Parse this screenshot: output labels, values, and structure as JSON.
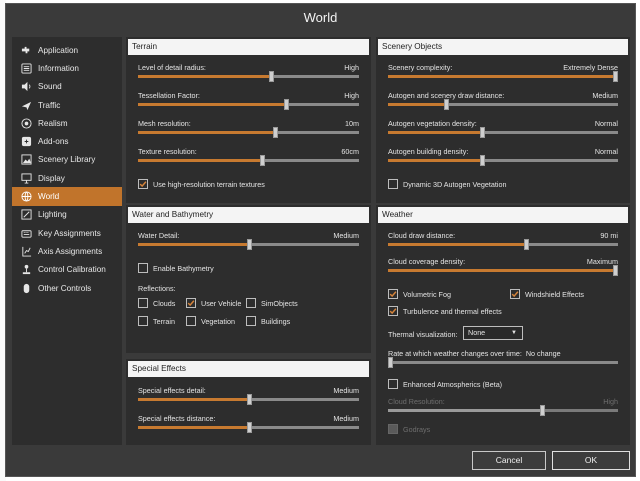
{
  "window": {
    "title": "World"
  },
  "sidebar": {
    "items": [
      {
        "label": "Application",
        "icon": "puzzle-icon"
      },
      {
        "label": "Information",
        "icon": "list-icon"
      },
      {
        "label": "Sound",
        "icon": "speaker-icon"
      },
      {
        "label": "Traffic",
        "icon": "airplane-icon"
      },
      {
        "label": "Realism",
        "icon": "target-icon"
      },
      {
        "label": "Add-ons",
        "icon": "addons-icon"
      },
      {
        "label": "Scenery Library",
        "icon": "scenery-icon"
      },
      {
        "label": "Display",
        "icon": "monitor-icon"
      },
      {
        "label": "World",
        "icon": "globe-icon",
        "active": true
      },
      {
        "label": "Lighting",
        "icon": "lighting-icon"
      },
      {
        "label": "Key Assignments",
        "icon": "keyboard-icon"
      },
      {
        "label": "Axis Assignments",
        "icon": "axis-icon"
      },
      {
        "label": "Control Calibration",
        "icon": "joystick-icon"
      },
      {
        "label": "Other Controls",
        "icon": "controller-icon"
      }
    ]
  },
  "terrain": {
    "title": "Terrain",
    "lod_label": "Level of detail radius:",
    "lod_value": "High",
    "lod_level": 0.6,
    "tess_label": "Tessellation Factor:",
    "tess_value": "High",
    "tess_level": 0.67,
    "mesh_label": "Mesh resolution:",
    "mesh_value": "10m",
    "mesh_level": 0.62,
    "tex_label": "Texture resolution:",
    "tex_value": "60cm",
    "tex_level": 0.56,
    "hires_label": "Use high-resolution terrain textures",
    "hires_checked": true
  },
  "scenery": {
    "title": "Scenery Objects",
    "complexity_label": "Scenery complexity:",
    "complexity_value": "Extremely Dense",
    "complexity_level": 1.0,
    "autogen_dist_label": "Autogen and scenery draw distance:",
    "autogen_dist_value": "Medium",
    "autogen_dist_level": 0.25,
    "veg_label": "Autogen vegetation density:",
    "veg_value": "Normal",
    "veg_level": 0.41,
    "bld_label": "Autogen building density:",
    "bld_value": "Normal",
    "bld_level": 0.41,
    "dyn_label": "Dynamic 3D Autogen Vegetation",
    "dyn_checked": false
  },
  "water": {
    "title": "Water and Bathymetry",
    "detail_label": "Water Detail:",
    "detail_value": "Medium",
    "detail_level": 0.5,
    "bathy_label": "Enable Bathymetry",
    "bathy_checked": false,
    "reflections_label": "Reflections:",
    "clouds_label": "Clouds",
    "clouds_checked": false,
    "uservehicle_label": "User Vehicle",
    "uservehicle_checked": true,
    "simobjects_label": "SimObjects",
    "simobjects_checked": false,
    "terrain_label": "Terrain",
    "terrain_checked": false,
    "vegetation_label": "Vegetation",
    "vegetation_checked": false,
    "buildings_label": "Buildings",
    "buildings_checked": false
  },
  "weather": {
    "title": "Weather",
    "cloud_dist_label": "Cloud draw distance:",
    "cloud_dist_value": "90 mi",
    "cloud_dist_level": 0.6,
    "cloud_cov_label": "Cloud coverage density:",
    "cloud_cov_value": "Maximum",
    "cloud_cov_level": 1.0,
    "volfog_label": "Volumetric Fog",
    "volfog_checked": true,
    "windshield_label": "Windshield Effects",
    "windshield_checked": true,
    "turb_label": "Turbulence and thermal effects",
    "turb_checked": true,
    "thermal_label": "Thermal visualization:",
    "thermal_value": "None",
    "rate_label": "Rate at which weather changes over time:",
    "rate_value": "No change",
    "rate_level": 0.0,
    "atmos_label": "Enhanced Atmospherics (Beta)",
    "atmos_checked": false,
    "cloudres_label": "Cloud Resolution:",
    "cloudres_value": "High",
    "cloudres_level": 0.67,
    "godrays_label": "Godrays",
    "godrays_checked": false
  },
  "effects": {
    "title": "Special Effects",
    "detail_label": "Special effects detail:",
    "detail_value": "Medium",
    "detail_level": 0.5,
    "dist_label": "Special effects distance:",
    "dist_value": "Medium",
    "dist_level": 0.5
  },
  "footer": {
    "cancel_label": "Cancel",
    "ok_label": "OK"
  },
  "colors": {
    "accent": "#c77a30",
    "panel": "#2d2d2d",
    "window": "#3a3a3a"
  }
}
